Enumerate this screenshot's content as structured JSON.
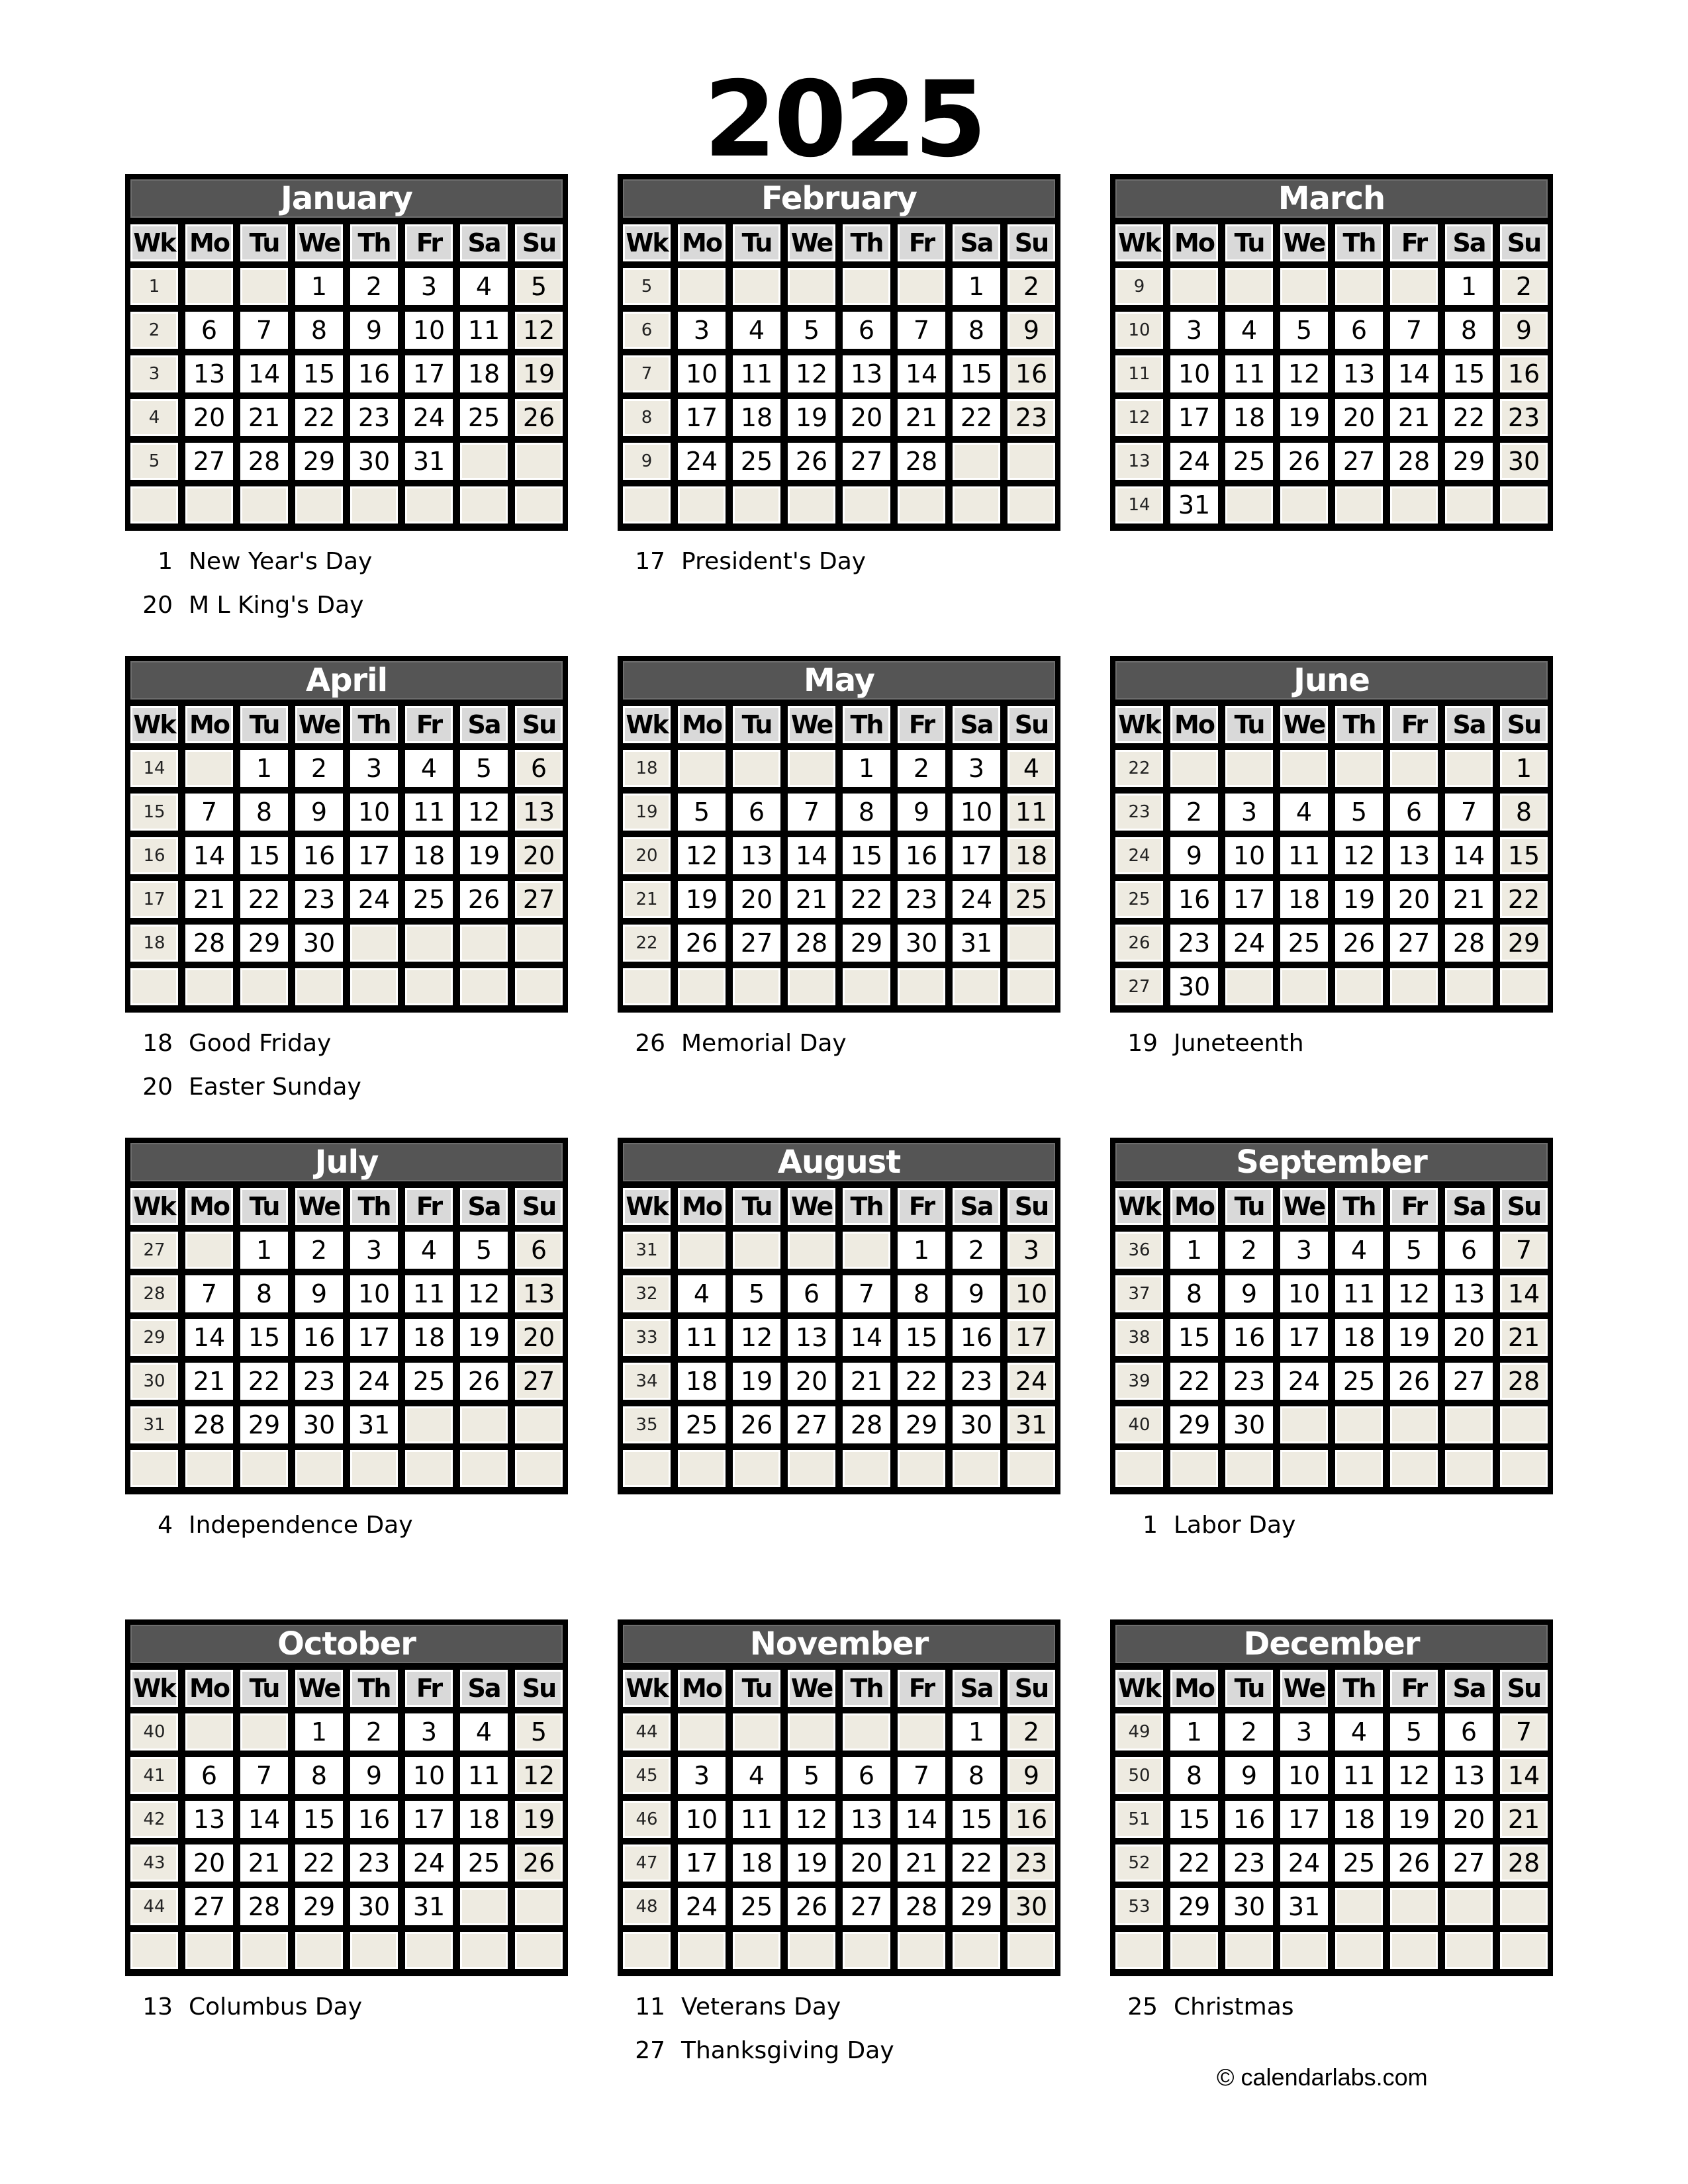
{
  "year": "2025",
  "weekday_headers": [
    "Wk",
    "Mo",
    "Tu",
    "We",
    "Th",
    "Fr",
    "Sa",
    "Su"
  ],
  "colors": {
    "month_header_bg": "#555555",
    "weekday_header_bg": "#d9d9d9",
    "weekend_and_week_bg": "#eeebe1",
    "weekday_bg": "#ffffff",
    "border": "#000000"
  },
  "months": [
    {
      "name": "January",
      "weeks": [
        {
          "wk": "1",
          "days": [
            "",
            "",
            "1",
            "2",
            "3",
            "4",
            "5"
          ]
        },
        {
          "wk": "2",
          "days": [
            "6",
            "7",
            "8",
            "9",
            "10",
            "11",
            "12"
          ]
        },
        {
          "wk": "3",
          "days": [
            "13",
            "14",
            "15",
            "16",
            "17",
            "18",
            "19"
          ]
        },
        {
          "wk": "4",
          "days": [
            "20",
            "21",
            "22",
            "23",
            "24",
            "25",
            "26"
          ]
        },
        {
          "wk": "5",
          "days": [
            "27",
            "28",
            "29",
            "30",
            "31",
            "",
            ""
          ]
        },
        {
          "wk": "",
          "days": [
            "",
            "",
            "",
            "",
            "",
            "",
            ""
          ]
        }
      ],
      "holidays": [
        {
          "day": "1",
          "name": "New Year's Day"
        },
        {
          "day": "20",
          "name": "M L King's Day"
        }
      ]
    },
    {
      "name": "February",
      "weeks": [
        {
          "wk": "5",
          "days": [
            "",
            "",
            "",
            "",
            "",
            "1",
            "2"
          ]
        },
        {
          "wk": "6",
          "days": [
            "3",
            "4",
            "5",
            "6",
            "7",
            "8",
            "9"
          ]
        },
        {
          "wk": "7",
          "days": [
            "10",
            "11",
            "12",
            "13",
            "14",
            "15",
            "16"
          ]
        },
        {
          "wk": "8",
          "days": [
            "17",
            "18",
            "19",
            "20",
            "21",
            "22",
            "23"
          ]
        },
        {
          "wk": "9",
          "days": [
            "24",
            "25",
            "26",
            "27",
            "28",
            "",
            ""
          ]
        },
        {
          "wk": "",
          "days": [
            "",
            "",
            "",
            "",
            "",
            "",
            ""
          ]
        }
      ],
      "holidays": [
        {
          "day": "17",
          "name": "President's Day"
        }
      ]
    },
    {
      "name": "March",
      "weeks": [
        {
          "wk": "9",
          "days": [
            "",
            "",
            "",
            "",
            "",
            "1",
            "2"
          ]
        },
        {
          "wk": "10",
          "days": [
            "3",
            "4",
            "5",
            "6",
            "7",
            "8",
            "9"
          ]
        },
        {
          "wk": "11",
          "days": [
            "10",
            "11",
            "12",
            "13",
            "14",
            "15",
            "16"
          ]
        },
        {
          "wk": "12",
          "days": [
            "17",
            "18",
            "19",
            "20",
            "21",
            "22",
            "23"
          ]
        },
        {
          "wk": "13",
          "days": [
            "24",
            "25",
            "26",
            "27",
            "28",
            "29",
            "30"
          ]
        },
        {
          "wk": "14",
          "days": [
            "31",
            "",
            "",
            "",
            "",
            "",
            ""
          ]
        }
      ],
      "holidays": []
    },
    {
      "name": "April",
      "weeks": [
        {
          "wk": "14",
          "days": [
            "",
            "1",
            "2",
            "3",
            "4",
            "5",
            "6"
          ]
        },
        {
          "wk": "15",
          "days": [
            "7",
            "8",
            "9",
            "10",
            "11",
            "12",
            "13"
          ]
        },
        {
          "wk": "16",
          "days": [
            "14",
            "15",
            "16",
            "17",
            "18",
            "19",
            "20"
          ]
        },
        {
          "wk": "17",
          "days": [
            "21",
            "22",
            "23",
            "24",
            "25",
            "26",
            "27"
          ]
        },
        {
          "wk": "18",
          "days": [
            "28",
            "29",
            "30",
            "",
            "",
            "",
            ""
          ]
        },
        {
          "wk": "",
          "days": [
            "",
            "",
            "",
            "",
            "",
            "",
            ""
          ]
        }
      ],
      "holidays": [
        {
          "day": "18",
          "name": "Good Friday"
        },
        {
          "day": "20",
          "name": "Easter Sunday"
        }
      ]
    },
    {
      "name": "May",
      "weeks": [
        {
          "wk": "18",
          "days": [
            "",
            "",
            "",
            "1",
            "2",
            "3",
            "4"
          ]
        },
        {
          "wk": "19",
          "days": [
            "5",
            "6",
            "7",
            "8",
            "9",
            "10",
            "11"
          ]
        },
        {
          "wk": "20",
          "days": [
            "12",
            "13",
            "14",
            "15",
            "16",
            "17",
            "18"
          ]
        },
        {
          "wk": "21",
          "days": [
            "19",
            "20",
            "21",
            "22",
            "23",
            "24",
            "25"
          ]
        },
        {
          "wk": "22",
          "days": [
            "26",
            "27",
            "28",
            "29",
            "30",
            "31",
            ""
          ]
        },
        {
          "wk": "",
          "days": [
            "",
            "",
            "",
            "",
            "",
            "",
            ""
          ]
        }
      ],
      "holidays": [
        {
          "day": "26",
          "name": "Memorial Day"
        }
      ]
    },
    {
      "name": "June",
      "weeks": [
        {
          "wk": "22",
          "days": [
            "",
            "",
            "",
            "",
            "",
            "",
            "1"
          ]
        },
        {
          "wk": "23",
          "days": [
            "2",
            "3",
            "4",
            "5",
            "6",
            "7",
            "8"
          ]
        },
        {
          "wk": "24",
          "days": [
            "9",
            "10",
            "11",
            "12",
            "13",
            "14",
            "15"
          ]
        },
        {
          "wk": "25",
          "days": [
            "16",
            "17",
            "18",
            "19",
            "20",
            "21",
            "22"
          ]
        },
        {
          "wk": "26",
          "days": [
            "23",
            "24",
            "25",
            "26",
            "27",
            "28",
            "29"
          ]
        },
        {
          "wk": "27",
          "days": [
            "30",
            "",
            "",
            "",
            "",
            "",
            ""
          ]
        }
      ],
      "holidays": [
        {
          "day": "19",
          "name": "Juneteenth"
        }
      ]
    },
    {
      "name": "July",
      "weeks": [
        {
          "wk": "27",
          "days": [
            "",
            "1",
            "2",
            "3",
            "4",
            "5",
            "6"
          ]
        },
        {
          "wk": "28",
          "days": [
            "7",
            "8",
            "9",
            "10",
            "11",
            "12",
            "13"
          ]
        },
        {
          "wk": "29",
          "days": [
            "14",
            "15",
            "16",
            "17",
            "18",
            "19",
            "20"
          ]
        },
        {
          "wk": "30",
          "days": [
            "21",
            "22",
            "23",
            "24",
            "25",
            "26",
            "27"
          ]
        },
        {
          "wk": "31",
          "days": [
            "28",
            "29",
            "30",
            "31",
            "",
            "",
            ""
          ]
        },
        {
          "wk": "",
          "days": [
            "",
            "",
            "",
            "",
            "",
            "",
            ""
          ]
        }
      ],
      "holidays": [
        {
          "day": "4",
          "name": "Independence Day"
        }
      ]
    },
    {
      "name": "August",
      "weeks": [
        {
          "wk": "31",
          "days": [
            "",
            "",
            "",
            "",
            "1",
            "2",
            "3"
          ]
        },
        {
          "wk": "32",
          "days": [
            "4",
            "5",
            "6",
            "7",
            "8",
            "9",
            "10"
          ]
        },
        {
          "wk": "33",
          "days": [
            "11",
            "12",
            "13",
            "14",
            "15",
            "16",
            "17"
          ]
        },
        {
          "wk": "34",
          "days": [
            "18",
            "19",
            "20",
            "21",
            "22",
            "23",
            "24"
          ]
        },
        {
          "wk": "35",
          "days": [
            "25",
            "26",
            "27",
            "28",
            "29",
            "30",
            "31"
          ]
        },
        {
          "wk": "",
          "days": [
            "",
            "",
            "",
            "",
            "",
            "",
            ""
          ]
        }
      ],
      "holidays": []
    },
    {
      "name": "September",
      "weeks": [
        {
          "wk": "36",
          "days": [
            "1",
            "2",
            "3",
            "4",
            "5",
            "6",
            "7"
          ]
        },
        {
          "wk": "37",
          "days": [
            "8",
            "9",
            "10",
            "11",
            "12",
            "13",
            "14"
          ]
        },
        {
          "wk": "38",
          "days": [
            "15",
            "16",
            "17",
            "18",
            "19",
            "20",
            "21"
          ]
        },
        {
          "wk": "39",
          "days": [
            "22",
            "23",
            "24",
            "25",
            "26",
            "27",
            "28"
          ]
        },
        {
          "wk": "40",
          "days": [
            "29",
            "30",
            "",
            "",
            "",
            "",
            ""
          ]
        },
        {
          "wk": "",
          "days": [
            "",
            "",
            "",
            "",
            "",
            "",
            ""
          ]
        }
      ],
      "holidays": [
        {
          "day": "1",
          "name": "Labor Day"
        }
      ]
    },
    {
      "name": "October",
      "weeks": [
        {
          "wk": "40",
          "days": [
            "",
            "",
            "1",
            "2",
            "3",
            "4",
            "5"
          ]
        },
        {
          "wk": "41",
          "days": [
            "6",
            "7",
            "8",
            "9",
            "10",
            "11",
            "12"
          ]
        },
        {
          "wk": "42",
          "days": [
            "13",
            "14",
            "15",
            "16",
            "17",
            "18",
            "19"
          ]
        },
        {
          "wk": "43",
          "days": [
            "20",
            "21",
            "22",
            "23",
            "24",
            "25",
            "26"
          ]
        },
        {
          "wk": "44",
          "days": [
            "27",
            "28",
            "29",
            "30",
            "31",
            "",
            ""
          ]
        },
        {
          "wk": "",
          "days": [
            "",
            "",
            "",
            "",
            "",
            "",
            ""
          ]
        }
      ],
      "holidays": [
        {
          "day": "13",
          "name": "Columbus Day"
        }
      ]
    },
    {
      "name": "November",
      "weeks": [
        {
          "wk": "44",
          "days": [
            "",
            "",
            "",
            "",
            "",
            "1",
            "2"
          ]
        },
        {
          "wk": "45",
          "days": [
            "3",
            "4",
            "5",
            "6",
            "7",
            "8",
            "9"
          ]
        },
        {
          "wk": "46",
          "days": [
            "10",
            "11",
            "12",
            "13",
            "14",
            "15",
            "16"
          ]
        },
        {
          "wk": "47",
          "days": [
            "17",
            "18",
            "19",
            "20",
            "21",
            "22",
            "23"
          ]
        },
        {
          "wk": "48",
          "days": [
            "24",
            "25",
            "26",
            "27",
            "28",
            "29",
            "30"
          ]
        },
        {
          "wk": "",
          "days": [
            "",
            "",
            "",
            "",
            "",
            "",
            ""
          ]
        }
      ],
      "holidays": [
        {
          "day": "11",
          "name": "Veterans Day"
        },
        {
          "day": "27",
          "name": "Thanksgiving Day"
        }
      ]
    },
    {
      "name": "December",
      "weeks": [
        {
          "wk": "49",
          "days": [
            "1",
            "2",
            "3",
            "4",
            "5",
            "6",
            "7"
          ]
        },
        {
          "wk": "50",
          "days": [
            "8",
            "9",
            "10",
            "11",
            "12",
            "13",
            "14"
          ]
        },
        {
          "wk": "51",
          "days": [
            "15",
            "16",
            "17",
            "18",
            "19",
            "20",
            "21"
          ]
        },
        {
          "wk": "52",
          "days": [
            "22",
            "23",
            "24",
            "25",
            "26",
            "27",
            "28"
          ]
        },
        {
          "wk": "53",
          "days": [
            "29",
            "30",
            "31",
            "",
            "",
            "",
            ""
          ]
        },
        {
          "wk": "",
          "days": [
            "",
            "",
            "",
            "",
            "",
            "",
            ""
          ]
        }
      ],
      "holidays": [
        {
          "day": "25",
          "name": "Christmas"
        }
      ]
    }
  ],
  "footer": {
    "copyright_icon": "copyright-icon",
    "text": "© calendarlabs.com"
  }
}
